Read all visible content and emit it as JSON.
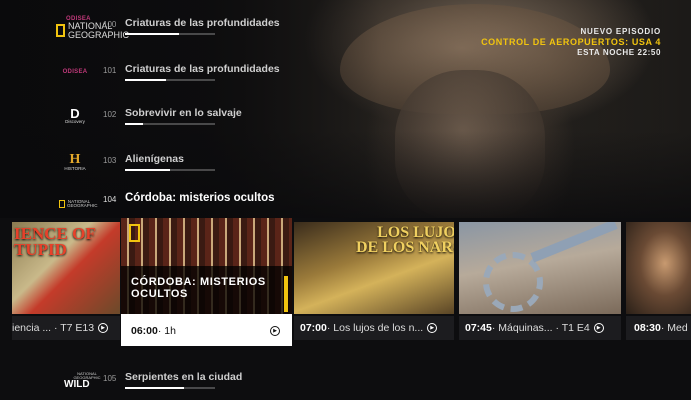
{
  "promo": {
    "kicker": "NUEVO EPISODIO",
    "title": "CONTROL DE AEROPUERTOS: USA 4",
    "time": "ESTA NOCHE 22:50"
  },
  "channels": [
    {
      "logo": "NATIONAL GEOGRAPHIC",
      "logo_sub": "ODISEA",
      "number": "100",
      "program": "Criaturas de las profundidades",
      "progress": 0.6
    },
    {
      "logo": "ODISEA",
      "number": "101",
      "program": "Criaturas de las profundidades",
      "progress": 0.45
    },
    {
      "logo": "Discovery",
      "number": "102",
      "program": "Sobrevivir en lo salvaje",
      "progress": 0.2
    },
    {
      "logo": "HISTORIA",
      "number": "103",
      "program": "Alienígenas",
      "progress": 0.5
    },
    {
      "logo": "NATIONAL GEOGRAPHIC",
      "number": "104",
      "program": "Córdoba: misterios ocultos",
      "progress": 0
    },
    {
      "logo": "WILD",
      "logo_sub": "NATIONAL GEOGRAPHIC",
      "number": "105",
      "program": "Serpientes en la ciudad",
      "progress": 0.65
    }
  ],
  "cards": [
    {
      "thumb_title": "IENCE OF\nTUPID",
      "caption_time": "",
      "caption_text": "iencia ... · T7 E13"
    },
    {
      "thumb_title": "CÓRDOBA: MISTERIOS OCULTOS",
      "caption_time": "06:00",
      "caption_text": " · 1h"
    },
    {
      "thumb_title": "LOS LUJOS\nDE LOS NARCOS",
      "caption_time": "07:00",
      "caption_text": " · Los lujos de los n..."
    },
    {
      "thumb_title": "",
      "caption_time": "07:45",
      "caption_text": " · Máquinas... · T1 E4"
    },
    {
      "thumb_title": "",
      "caption_time": "08:30",
      "caption_text": " · Med"
    }
  ],
  "colors": {
    "accent": "#f1c40f",
    "background": "#0d0d0f",
    "focus_card": "#ffffff"
  },
  "icons": [
    "play-circle-icon",
    "natgeo-logo",
    "discovery-logo",
    "historia-logo",
    "odisea-logo",
    "natgeo-wild-logo"
  ]
}
